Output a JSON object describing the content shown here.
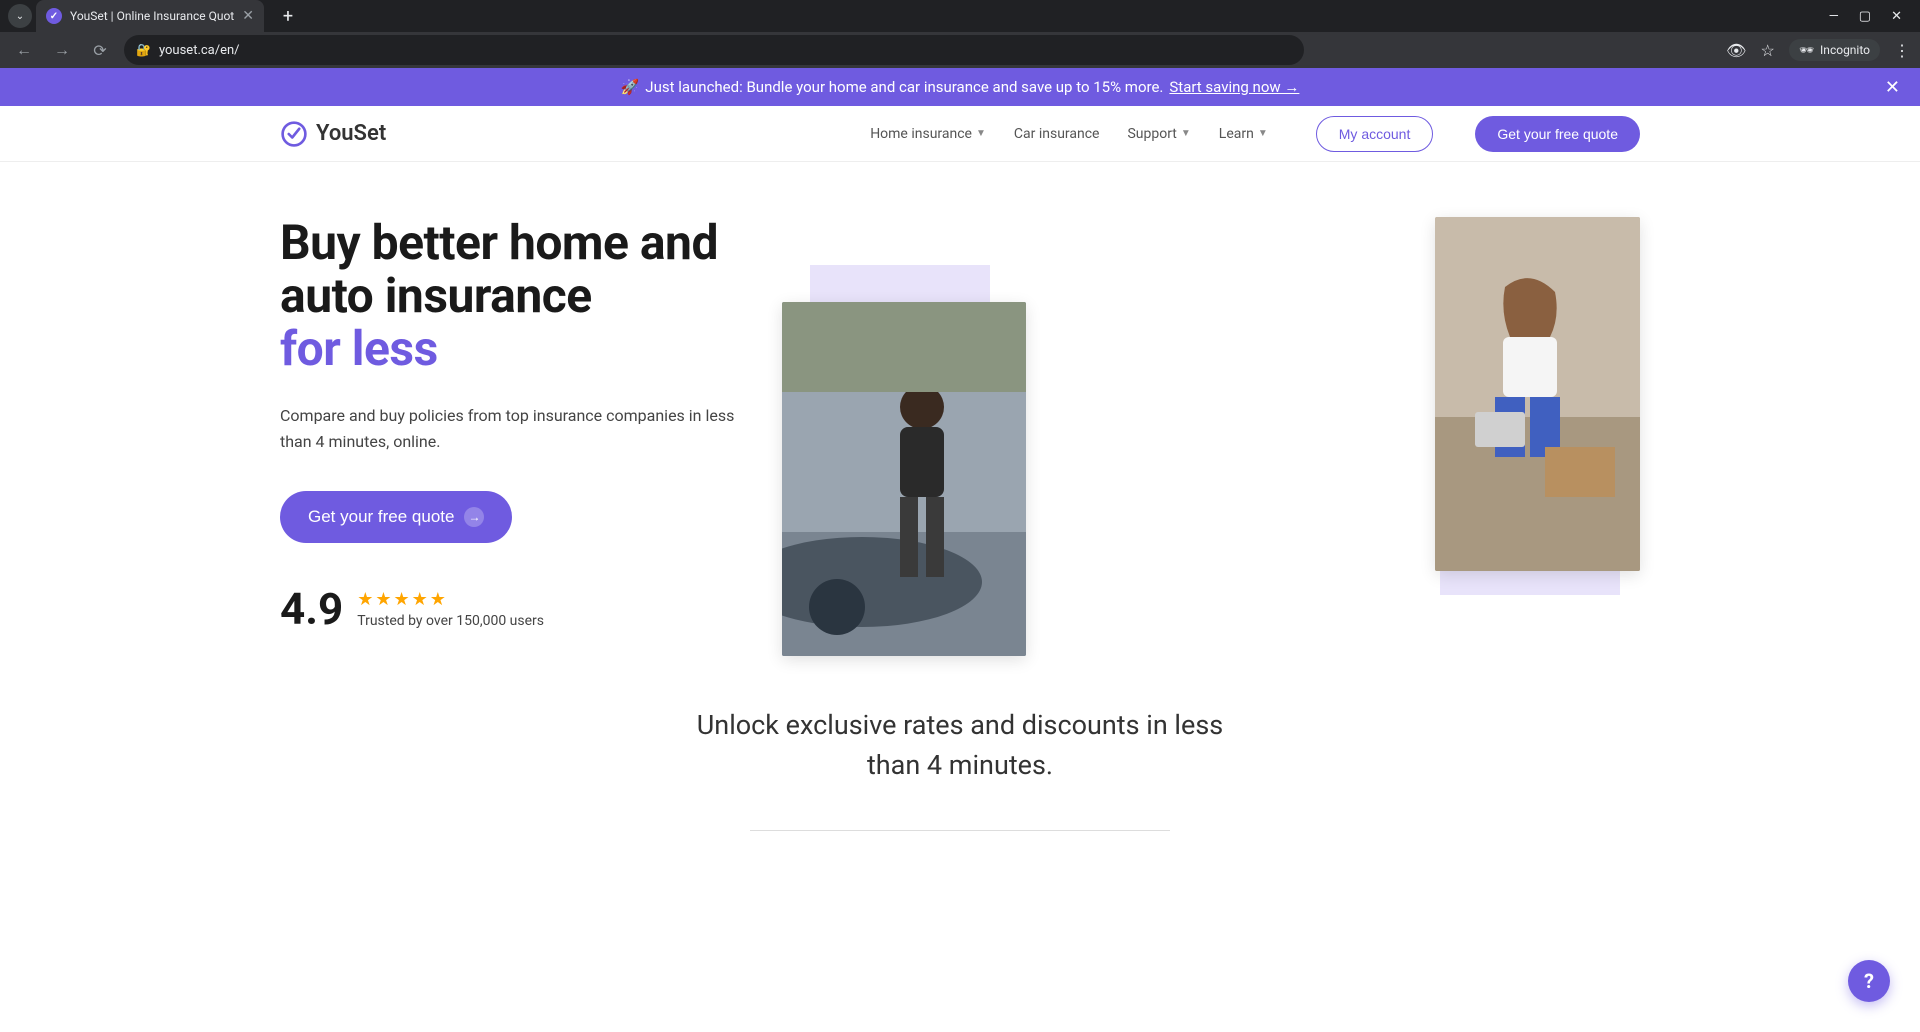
{
  "browser": {
    "tab_title": "YouSet | Online Insurance Quot",
    "url": "youset.ca/en/",
    "incognito": "Incognito"
  },
  "banner": {
    "rocket": "🚀",
    "text": "Just launched: Bundle your home and car insurance and save up to 15% more.",
    "link": "Start saving now →"
  },
  "brand": "YouSet",
  "nav": {
    "home_insurance": "Home insurance",
    "car_insurance": "Car insurance",
    "support": "Support",
    "learn": "Learn",
    "my_account": "My account",
    "get_quote": "Get your free quote"
  },
  "hero": {
    "headline_l1": "Buy better home and",
    "headline_l2": "auto insurance",
    "headline_l3": "for less",
    "subtitle": "Compare and buy policies from top insurance companies in less than 4 minutes, online.",
    "cta": "Get your free quote",
    "rating": "4.9",
    "trusted": "Trusted by over 150,000 users"
  },
  "section": {
    "title": "Unlock exclusive rates and discounts in less than 4 minutes."
  },
  "help": "?"
}
